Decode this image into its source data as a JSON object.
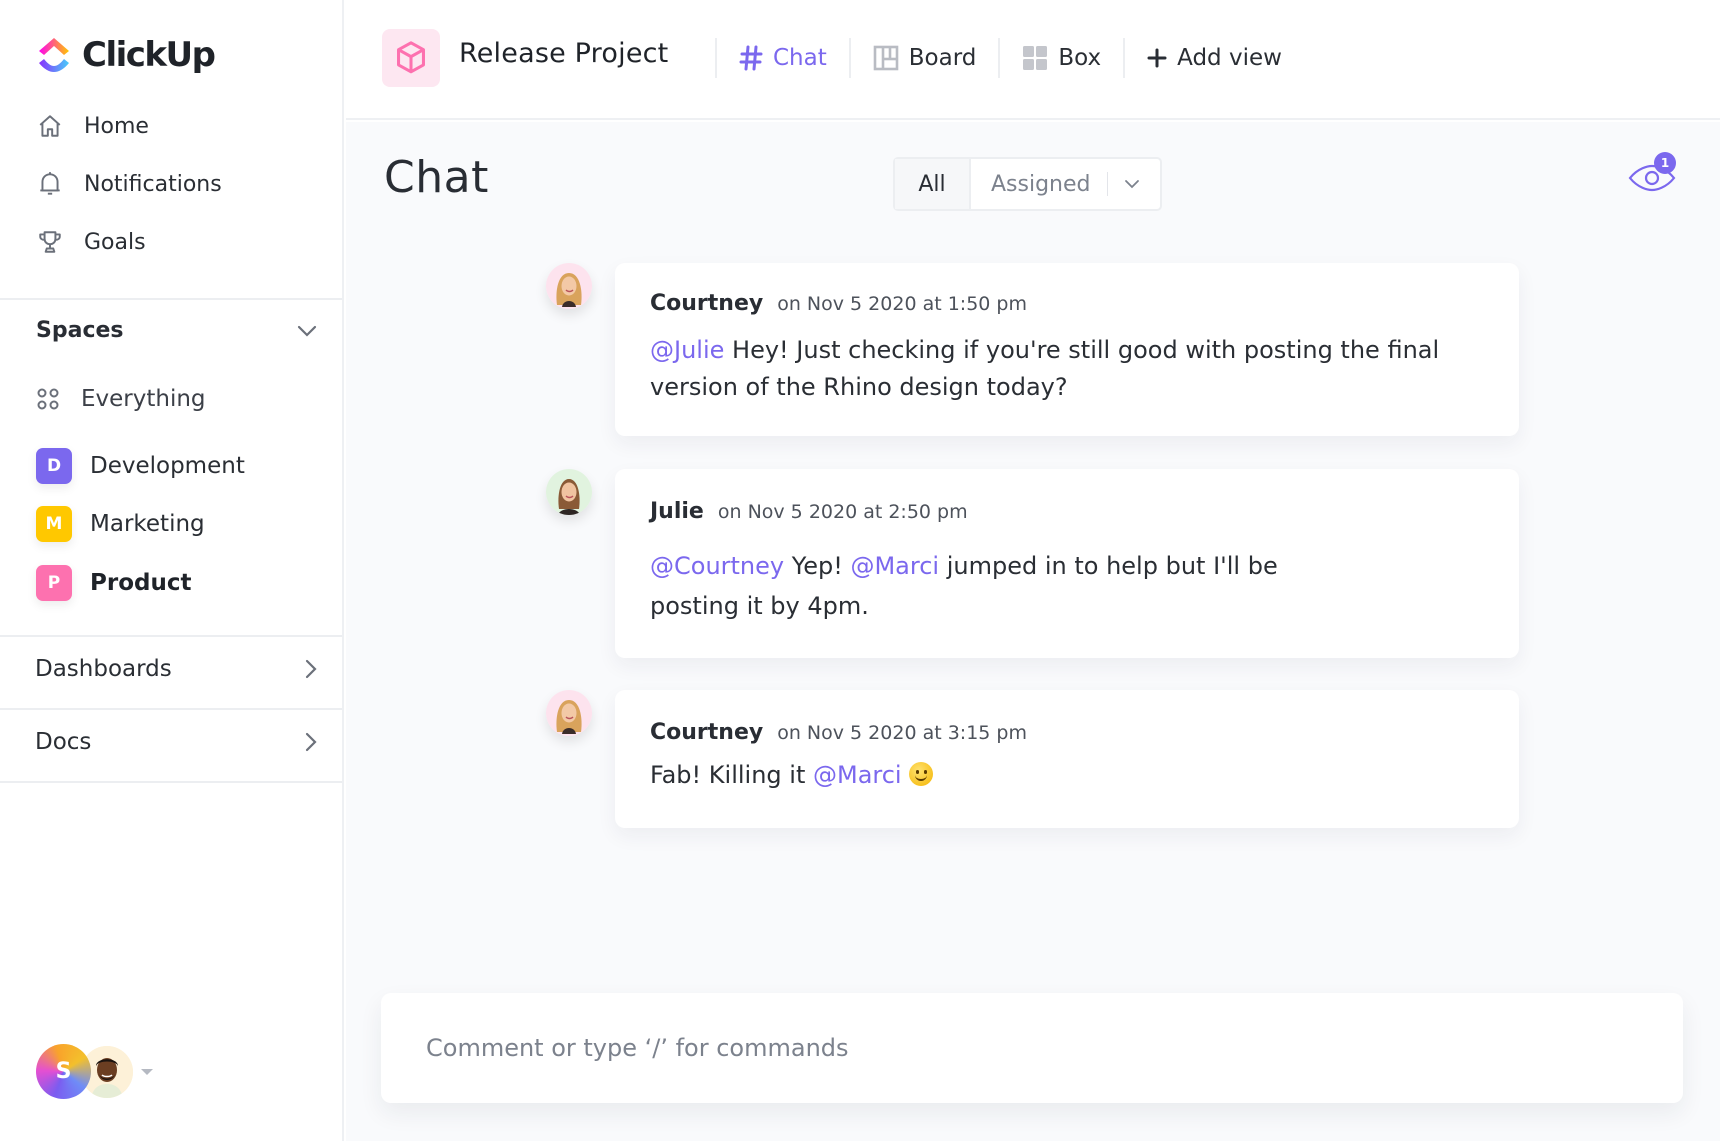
{
  "app": {
    "name": "ClickUp",
    "accent_color": "#7b68ee"
  },
  "sidebar": {
    "nav": [
      {
        "label": "Home",
        "icon": "home-icon"
      },
      {
        "label": "Notifications",
        "icon": "bell-icon"
      },
      {
        "label": "Goals",
        "icon": "trophy-icon"
      }
    ],
    "spaces_title": "Spaces",
    "everything_label": "Everything",
    "spaces": [
      {
        "initial": "D",
        "label": "Development",
        "color": "#7b68ee",
        "bold": false
      },
      {
        "initial": "M",
        "label": "Marketing",
        "color": "#ffc800",
        "bold": false
      },
      {
        "initial": "P",
        "label": "Product",
        "color": "#fd71af",
        "bold": true
      }
    ],
    "sections": [
      {
        "label": "Dashboards"
      },
      {
        "label": "Docs"
      }
    ],
    "user_initial": "S"
  },
  "header": {
    "project_title": "Release Project",
    "views": [
      {
        "label": "Chat",
        "icon": "hash-icon",
        "active": true
      },
      {
        "label": "Board",
        "icon": "board-icon",
        "active": false
      },
      {
        "label": "Box",
        "icon": "box-grid-icon",
        "active": false
      },
      {
        "label": "Add view",
        "icon": "plus-icon",
        "active": false
      }
    ]
  },
  "main": {
    "title": "Chat",
    "filter": {
      "all_label": "All",
      "assigned_label": "Assigned"
    },
    "watchers_count": "1",
    "messages": [
      {
        "author": "Courtney",
        "time": "on Nov 5 2020 at 1:50 pm",
        "avatar_bg": "#fde3ee",
        "parts": [
          {
            "type": "mention",
            "text": "@Julie"
          },
          {
            "type": "text",
            "text": " Hey! Just checking if you're still good with posting the final version of the Rhino design today?"
          }
        ]
      },
      {
        "author": "Julie",
        "time": "on Nov 5 2020 at 2:50 pm",
        "avatar_bg": "#e1f3df",
        "parts": [
          {
            "type": "mention",
            "text": "@Courtney"
          },
          {
            "type": "text",
            "text": " Yep! "
          },
          {
            "type": "mention",
            "text": "@Marci"
          },
          {
            "type": "text",
            "text": " jumped in to help but I'll be posting it by 4pm."
          }
        ]
      },
      {
        "author": "Courtney",
        "time": "on Nov 5 2020 at 3:15 pm",
        "avatar_bg": "#fde3ee",
        "parts": [
          {
            "type": "text",
            "text": "Fab! Killing it "
          },
          {
            "type": "mention",
            "text": "@Marci"
          },
          {
            "type": "text",
            "text": " "
          },
          {
            "type": "emoji",
            "text": "slightly-smiling-face"
          }
        ]
      }
    ],
    "comment_placeholder": "Comment or type ‘/’ for commands"
  }
}
